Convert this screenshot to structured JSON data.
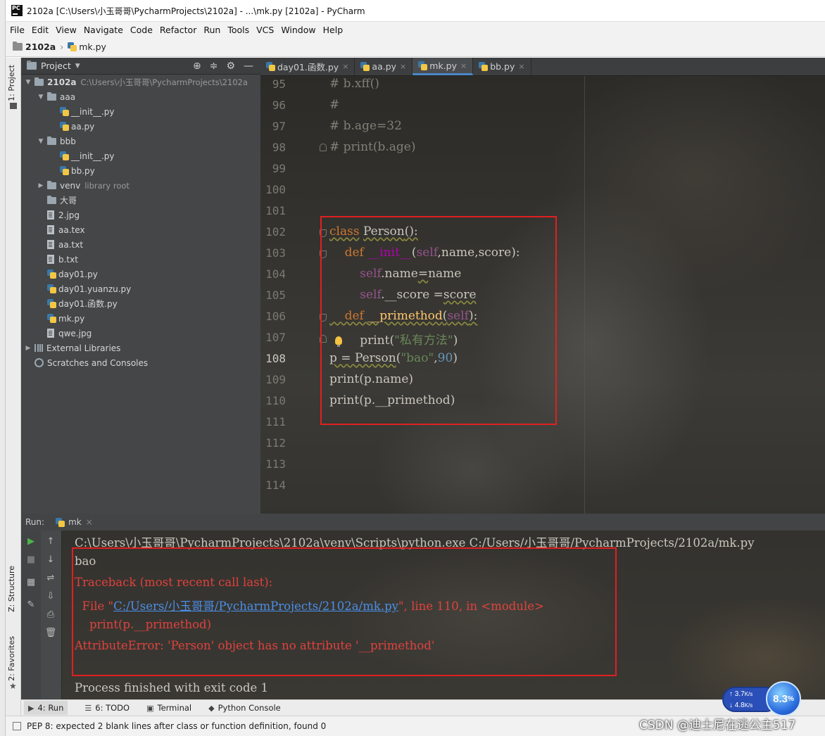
{
  "window": {
    "title": "2102a [C:\\Users\\小玉哥哥\\PycharmProjects\\2102a] - ...\\mk.py [2102a] - PyCharm"
  },
  "menu": [
    "File",
    "Edit",
    "View",
    "Navigate",
    "Code",
    "Refactor",
    "Run",
    "Tools",
    "VCS",
    "Window",
    "Help"
  ],
  "breadcrumb": {
    "project": "2102a",
    "file": "mk.py"
  },
  "left_strip": {
    "project_tab": "1: Project",
    "structure_tab": "Z: Structure",
    "favorites_tab": "2: Favorites"
  },
  "project_panel": {
    "title": "Project",
    "root": {
      "name": "2102a",
      "path": "C:\\Users\\小玉哥哥\\PycharmProjects\\2102a"
    },
    "items": [
      {
        "name": "aaa",
        "kind": "folder",
        "depth": 1,
        "expanded": true
      },
      {
        "name": "__init__.py",
        "kind": "py",
        "depth": 2
      },
      {
        "name": "aa.py",
        "kind": "py",
        "depth": 2
      },
      {
        "name": "bbb",
        "kind": "folder",
        "depth": 1,
        "expanded": true
      },
      {
        "name": "__init__.py",
        "kind": "py",
        "depth": 2
      },
      {
        "name": "bb.py",
        "kind": "py",
        "depth": 2
      },
      {
        "name": "venv",
        "extra": "library root",
        "kind": "folder",
        "depth": 1,
        "expanded": false
      },
      {
        "name": "大哥",
        "kind": "folder",
        "depth": 1
      },
      {
        "name": "2.jpg",
        "kind": "file",
        "depth": 1
      },
      {
        "name": "aa.tex",
        "kind": "file",
        "depth": 1
      },
      {
        "name": "aa.txt",
        "kind": "file",
        "depth": 1
      },
      {
        "name": "b.txt",
        "kind": "file",
        "depth": 1
      },
      {
        "name": "day01.py",
        "kind": "py",
        "depth": 1
      },
      {
        "name": "day01.yuanzu.py",
        "kind": "py",
        "depth": 1
      },
      {
        "name": "day01.函数.py",
        "kind": "py",
        "depth": 1
      },
      {
        "name": "mk.py",
        "kind": "py",
        "depth": 1
      },
      {
        "name": "qwe.jpg",
        "kind": "file",
        "depth": 1
      }
    ],
    "external_libraries": "External Libraries",
    "scratches": "Scratches and Consoles"
  },
  "tabs": [
    {
      "label": "day01.函数.py",
      "active": false
    },
    {
      "label": "aa.py",
      "active": false
    },
    {
      "label": "mk.py",
      "active": true
    },
    {
      "label": "bb.py",
      "active": false
    }
  ],
  "editor": {
    "current_line": 108,
    "lines": [
      {
        "n": "95",
        "text": "# b.xff()"
      },
      {
        "n": "96",
        "text": "#"
      },
      {
        "n": "97",
        "text": "# b.age=32"
      },
      {
        "n": "98",
        "text": "# print(b.age)"
      },
      {
        "n": "99",
        "text": ""
      },
      {
        "n": "100",
        "text": ""
      },
      {
        "n": "101",
        "text": ""
      },
      {
        "n": "102",
        "parts": [
          {
            "t": "class",
            "c": "kw ul"
          },
          {
            "t": " ",
            "c": "plain"
          },
          {
            "t": "Person",
            "c": "plain ul"
          },
          {
            "t": "():",
            "c": "plain ul"
          }
        ]
      },
      {
        "n": "103",
        "parts": [
          {
            "t": "    def ",
            "c": "kw"
          },
          {
            "t": "__init__",
            "c": "magic"
          },
          {
            "t": "(",
            "c": "plain"
          },
          {
            "t": "self",
            "c": "self"
          },
          {
            "t": ",",
            "c": "plain"
          },
          {
            "t": "name",
            "c": "plain"
          },
          {
            "t": ",",
            "c": "plain"
          },
          {
            "t": "score",
            "c": "plain"
          },
          {
            "t": "):",
            "c": "plain"
          }
        ]
      },
      {
        "n": "104",
        "parts": [
          {
            "t": "        ",
            "c": "plain"
          },
          {
            "t": "self",
            "c": "self"
          },
          {
            "t": ".name",
            "c": "plain"
          },
          {
            "t": "=",
            "c": "plain ul"
          },
          {
            "t": "name",
            "c": "plain"
          }
        ]
      },
      {
        "n": "105",
        "parts": [
          {
            "t": "        ",
            "c": "plain"
          },
          {
            "t": "self",
            "c": "self"
          },
          {
            "t": ".__score =",
            "c": "plain"
          },
          {
            "t": "score",
            "c": "plain ul"
          }
        ]
      },
      {
        "n": "106",
        "parts": [
          {
            "t": "    def ",
            "c": "kw ul"
          },
          {
            "t": "__primethod",
            "c": "fn ul"
          },
          {
            "t": "(",
            "c": "plain ul"
          },
          {
            "t": "self",
            "c": "self ul"
          },
          {
            "t": "):",
            "c": "plain ul"
          }
        ]
      },
      {
        "n": "107",
        "parts": [
          {
            "t": "        print",
            "c": "plain"
          },
          {
            "t": "(",
            "c": "plain"
          },
          {
            "t": "\"私有方法\"",
            "c": "str"
          },
          {
            "t": ")",
            "c": "plain"
          }
        ]
      },
      {
        "n": "108",
        "parts": [
          {
            "t": "p = ",
            "c": "plain ul"
          },
          {
            "t": "Person",
            "c": "plain ul"
          },
          {
            "t": "(",
            "c": "plain"
          },
          {
            "t": "\"bao\"",
            "c": "str"
          },
          {
            "t": ",",
            "c": "plain"
          },
          {
            "t": "90",
            "c": "num"
          },
          {
            "t": ")",
            "c": "plain"
          }
        ]
      },
      {
        "n": "109",
        "parts": [
          {
            "t": "print",
            "c": "plain"
          },
          {
            "t": "(p.name)",
            "c": "plain"
          }
        ]
      },
      {
        "n": "110",
        "parts": [
          {
            "t": "print",
            "c": "plain"
          },
          {
            "t": "(p.",
            "c": "plain"
          },
          {
            "t": "__primethod",
            "c": "plain"
          },
          {
            "t": ")",
            "c": "plain"
          }
        ]
      },
      {
        "n": "111",
        "text": ""
      },
      {
        "n": "112",
        "text": ""
      },
      {
        "n": "113",
        "text": ""
      },
      {
        "n": "114",
        "text": ""
      }
    ]
  },
  "run": {
    "label": "Run:",
    "config": "mk",
    "console": [
      {
        "text": "C:\\Users\\小玉哥哥\\PycharmProjects\\2102a\\venv\\Scripts\\python.exe C:/Users/小玉哥哥/PycharmProjects/2102a/mk.py",
        "kind": "normal"
      },
      {
        "text": "bao",
        "kind": "normal"
      },
      {
        "text": "Traceback (most recent call last):",
        "kind": "err"
      },
      {
        "kind": "file",
        "pre": "  File \"",
        "link": "C:/Users/小玉哥哥/PycharmProjects/2102a/mk.py",
        "post": "\", line 110, in <module>"
      },
      {
        "text": "    print(p.__primethod)",
        "kind": "err"
      },
      {
        "text": "AttributeError: 'Person' object has no attribute '__primethod'",
        "kind": "err"
      },
      {
        "text": "",
        "kind": "normal"
      },
      {
        "text": "Process finished with exit code 1",
        "kind": "normal"
      }
    ]
  },
  "bottom_tools": [
    {
      "label": "4: Run",
      "glyph": "▶",
      "active": true
    },
    {
      "label": "6: TODO",
      "glyph": "☰",
      "active": false
    },
    {
      "label": "Terminal",
      "glyph": "▣",
      "active": false
    },
    {
      "label": "Python Console",
      "glyph": "◆",
      "active": false
    }
  ],
  "status": {
    "message": "PEP 8: expected 2 blank lines after class or function definition, found 0"
  },
  "net_widget": {
    "up": "3.7",
    "up_unit": "K/s",
    "down": "4.8",
    "down_unit": "K/s",
    "percent": "8.3",
    "percent_sign": "%"
  },
  "watermark": "CSDN @迪士尼在逃公主517"
}
